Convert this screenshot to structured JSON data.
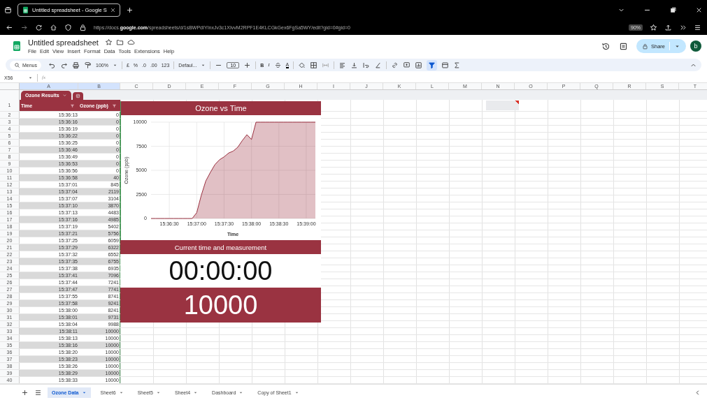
{
  "browser": {
    "tab_title": "Untitled spreadsheet - Google S",
    "url": "https://docs.**google.com**/spreadsheets/d/1sBWPdIYInxJv3c1XIvvM2RPF1E4KLCGkGex6FgSa5WY/edit?gid=0#gid=0",
    "zoom": "90%"
  },
  "doc": {
    "title": "Untitled spreadsheet",
    "menus": [
      "File",
      "Edit",
      "View",
      "Insert",
      "Format",
      "Data",
      "Tools",
      "Extensions",
      "Help"
    ],
    "share": "Share",
    "avatar": "b"
  },
  "toolbar": {
    "search": "Menus",
    "zoom": "100%",
    "currency": "£",
    "percent": "%",
    "decimal_decrease": ".0",
    "decimal_increase": ".00",
    "number_format": "123",
    "font": "Defaul...",
    "font_size": "10",
    "bold": "B",
    "italic": "I",
    "text_color": "A",
    "filter_on": true
  },
  "formula_bar": {
    "name_box": "X56",
    "fx": "fx"
  },
  "columns": [
    "A",
    "B",
    "C",
    "D",
    "E",
    "F",
    "G",
    "H",
    "I",
    "J",
    "K",
    "L",
    "M",
    "N",
    "O",
    "P",
    "Q",
    "R",
    "S",
    "T"
  ],
  "table": {
    "name": "Ozone Results",
    "header_row": "1",
    "headers": [
      "Time",
      "Ozone (ppb)"
    ],
    "rows": [
      {
        "row": "2",
        "time": "15:36:13",
        "ozone": "0"
      },
      {
        "row": "3",
        "time": "15:36:16",
        "ozone": "0"
      },
      {
        "row": "4",
        "time": "15:36:19",
        "ozone": "0"
      },
      {
        "row": "5",
        "time": "15:36:22",
        "ozone": "0"
      },
      {
        "row": "6",
        "time": "15:36:25",
        "ozone": "0"
      },
      {
        "row": "7",
        "time": "15:36:46",
        "ozone": "0"
      },
      {
        "row": "8",
        "time": "15:36:49",
        "ozone": "0"
      },
      {
        "row": "9",
        "time": "15:36:53",
        "ozone": "0"
      },
      {
        "row": "10",
        "time": "15:36:56",
        "ozone": "0"
      },
      {
        "row": "11",
        "time": "15:36:58",
        "ozone": "40"
      },
      {
        "row": "12",
        "time": "15:37:01",
        "ozone": "845"
      },
      {
        "row": "13",
        "time": "15:37:04",
        "ozone": "2119"
      },
      {
        "row": "14",
        "time": "15:37:07",
        "ozone": "3104"
      },
      {
        "row": "15",
        "time": "15:37:10",
        "ozone": "3870"
      },
      {
        "row": "16",
        "time": "15:37:13",
        "ozone": "4483"
      },
      {
        "row": "17",
        "time": "15:37:16",
        "ozone": "4985"
      },
      {
        "row": "18",
        "time": "15:37:19",
        "ozone": "5402"
      },
      {
        "row": "19",
        "time": "15:37:21",
        "ozone": "5756"
      },
      {
        "row": "20",
        "time": "15:37:25",
        "ozone": "6059"
      },
      {
        "row": "21",
        "time": "15:37:29",
        "ozone": "6322"
      },
      {
        "row": "22",
        "time": "15:37:32",
        "ozone": "6552"
      },
      {
        "row": "23",
        "time": "15:37:35",
        "ozone": "6755"
      },
      {
        "row": "24",
        "time": "15:37:38",
        "ozone": "6935"
      },
      {
        "row": "25",
        "time": "15:37:41",
        "ozone": "7096"
      },
      {
        "row": "26",
        "time": "15:37:44",
        "ozone": "7241"
      },
      {
        "row": "27",
        "time": "15:37:47",
        "ozone": "7741"
      },
      {
        "row": "28",
        "time": "15:37:55",
        "ozone": "8741"
      },
      {
        "row": "29",
        "time": "15:37:58",
        "ozone": "9241"
      },
      {
        "row": "30",
        "time": "15:38:00",
        "ozone": "8241"
      },
      {
        "row": "31",
        "time": "15:38:01",
        "ozone": "9731"
      },
      {
        "row": "32",
        "time": "15:38:04",
        "ozone": "9988"
      },
      {
        "row": "33",
        "time": "15:38:11",
        "ozone": "10000"
      },
      {
        "row": "34",
        "time": "15:38:13",
        "ozone": "10000"
      },
      {
        "row": "35",
        "time": "15:38:16",
        "ozone": "10000"
      },
      {
        "row": "36",
        "time": "15:38:20",
        "ozone": "10000"
      },
      {
        "row": "37",
        "time": "15:38:23",
        "ozone": "10000"
      },
      {
        "row": "38",
        "time": "15:38:26",
        "ozone": "10000"
      },
      {
        "row": "39",
        "time": "15:38:29",
        "ozone": "10000"
      },
      {
        "row": "40",
        "time": "15:38:33",
        "ozone": "10000"
      }
    ]
  },
  "chart": {
    "chart_data": {
      "type": "area",
      "title": "Ozone vs Time",
      "xlabel": "Time",
      "ylabel": "Ozone (ppb)",
      "categories": [
        null,
        null,
        null,
        null,
        "15:36:30",
        null,
        null,
        null,
        null,
        null,
        "15:37:00",
        null,
        null,
        null,
        null,
        null,
        "15:37:30",
        null,
        null,
        null,
        null,
        null,
        "15:38:00",
        null,
        null,
        null,
        null,
        null,
        "15:38:30",
        null,
        null,
        null,
        null,
        null,
        "15:39:00",
        null,
        null
      ],
      "series": [
        {
          "color": "#9b3040",
          "values": [
            0,
            0,
            0,
            0,
            0,
            0,
            0,
            0,
            0,
            0,
            600,
            2400,
            3900,
            4800,
            5600,
            6100,
            6400,
            6800,
            7000,
            7400,
            8100,
            8700,
            8200,
            10000,
            10000,
            10000,
            10000,
            10000,
            10000,
            10000,
            10000,
            10000,
            10000,
            10000,
            10000,
            10000,
            10000
          ]
        }
      ],
      "ylim": [
        0,
        10000
      ],
      "grid": true,
      "yticks": [
        0,
        2500,
        5000,
        7500,
        10000
      ]
    }
  },
  "widget": {
    "title": "Current time and measurement",
    "time": "00:00:00",
    "value": "10000"
  },
  "sheet_tabs": [
    {
      "label": "Ozone Data",
      "selected": true
    },
    {
      "label": "Sheet6",
      "selected": false
    },
    {
      "label": "Sheet5",
      "selected": false
    },
    {
      "label": "Sheet4",
      "selected": false
    },
    {
      "label": "Dashboard",
      "selected": false
    },
    {
      "label": "Copy of Sheet1",
      "selected": false
    }
  ]
}
